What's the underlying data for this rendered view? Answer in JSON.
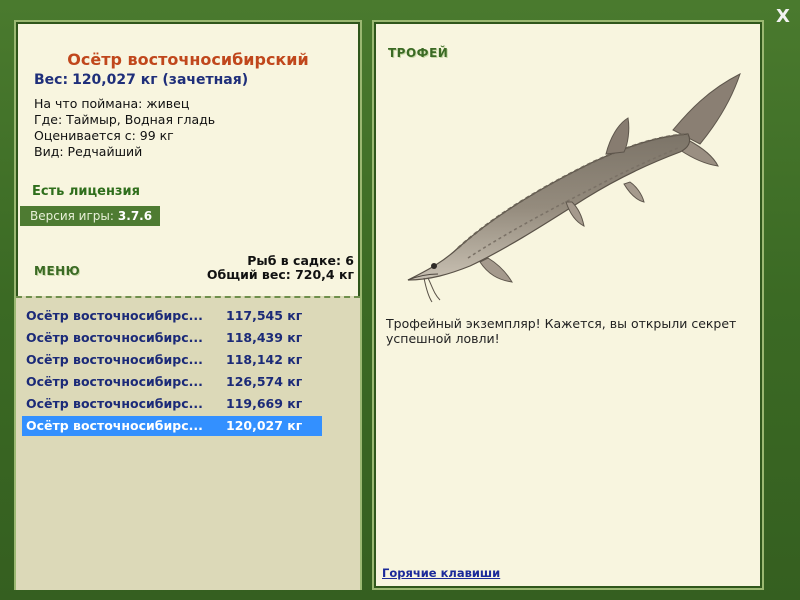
{
  "close_label": "X",
  "fish": {
    "title": "Осётр восточносибирский",
    "weight_label": "Вес:",
    "weight_value": "120,027 кг (зачетная)",
    "info": [
      "На что поймана: живец",
      "Где: Таймыр, Водная гладь",
      "Оценивается с: 99 кг",
      "Вид: Редчайший"
    ]
  },
  "license": "Есть лицензия",
  "version": {
    "label": "Версия игры:",
    "value": "3.7.6"
  },
  "menu": {
    "title": "МЕНЮ"
  },
  "cage": {
    "count": "Рыб в садке: 6",
    "total": "Общий вес: 720,4 кг"
  },
  "catch_list": [
    {
      "name": "Осётр восточносибирс...",
      "weight": "117,545 кг"
    },
    {
      "name": "Осётр восточносибирс...",
      "weight": "118,439 кг"
    },
    {
      "name": "Осётр восточносибирс...",
      "weight": "118,142 кг"
    },
    {
      "name": "Осётр восточносибирс...",
      "weight": "126,574 кг"
    },
    {
      "name": "Осётр восточносибирс...",
      "weight": "119,669 кг"
    },
    {
      "name": "Осётр восточносибирс...",
      "weight": "120,027 кг",
      "selected": true
    }
  ],
  "trophy": {
    "title": "ТРОФЕЙ",
    "image": "sturgeon-illustration",
    "description": "Трофейный экземпляр! Кажется, вы открыли секрет успешной ловли!"
  },
  "hotkeys_link": "Горячие клавиши",
  "colors": {
    "frame": "#3e6b27",
    "panel": "#f8f5df",
    "list_bg": "#dcd9b8",
    "selected_row": "#3390ff",
    "title_orange": "#c0471c",
    "weight_blue": "#1f2f7a"
  }
}
